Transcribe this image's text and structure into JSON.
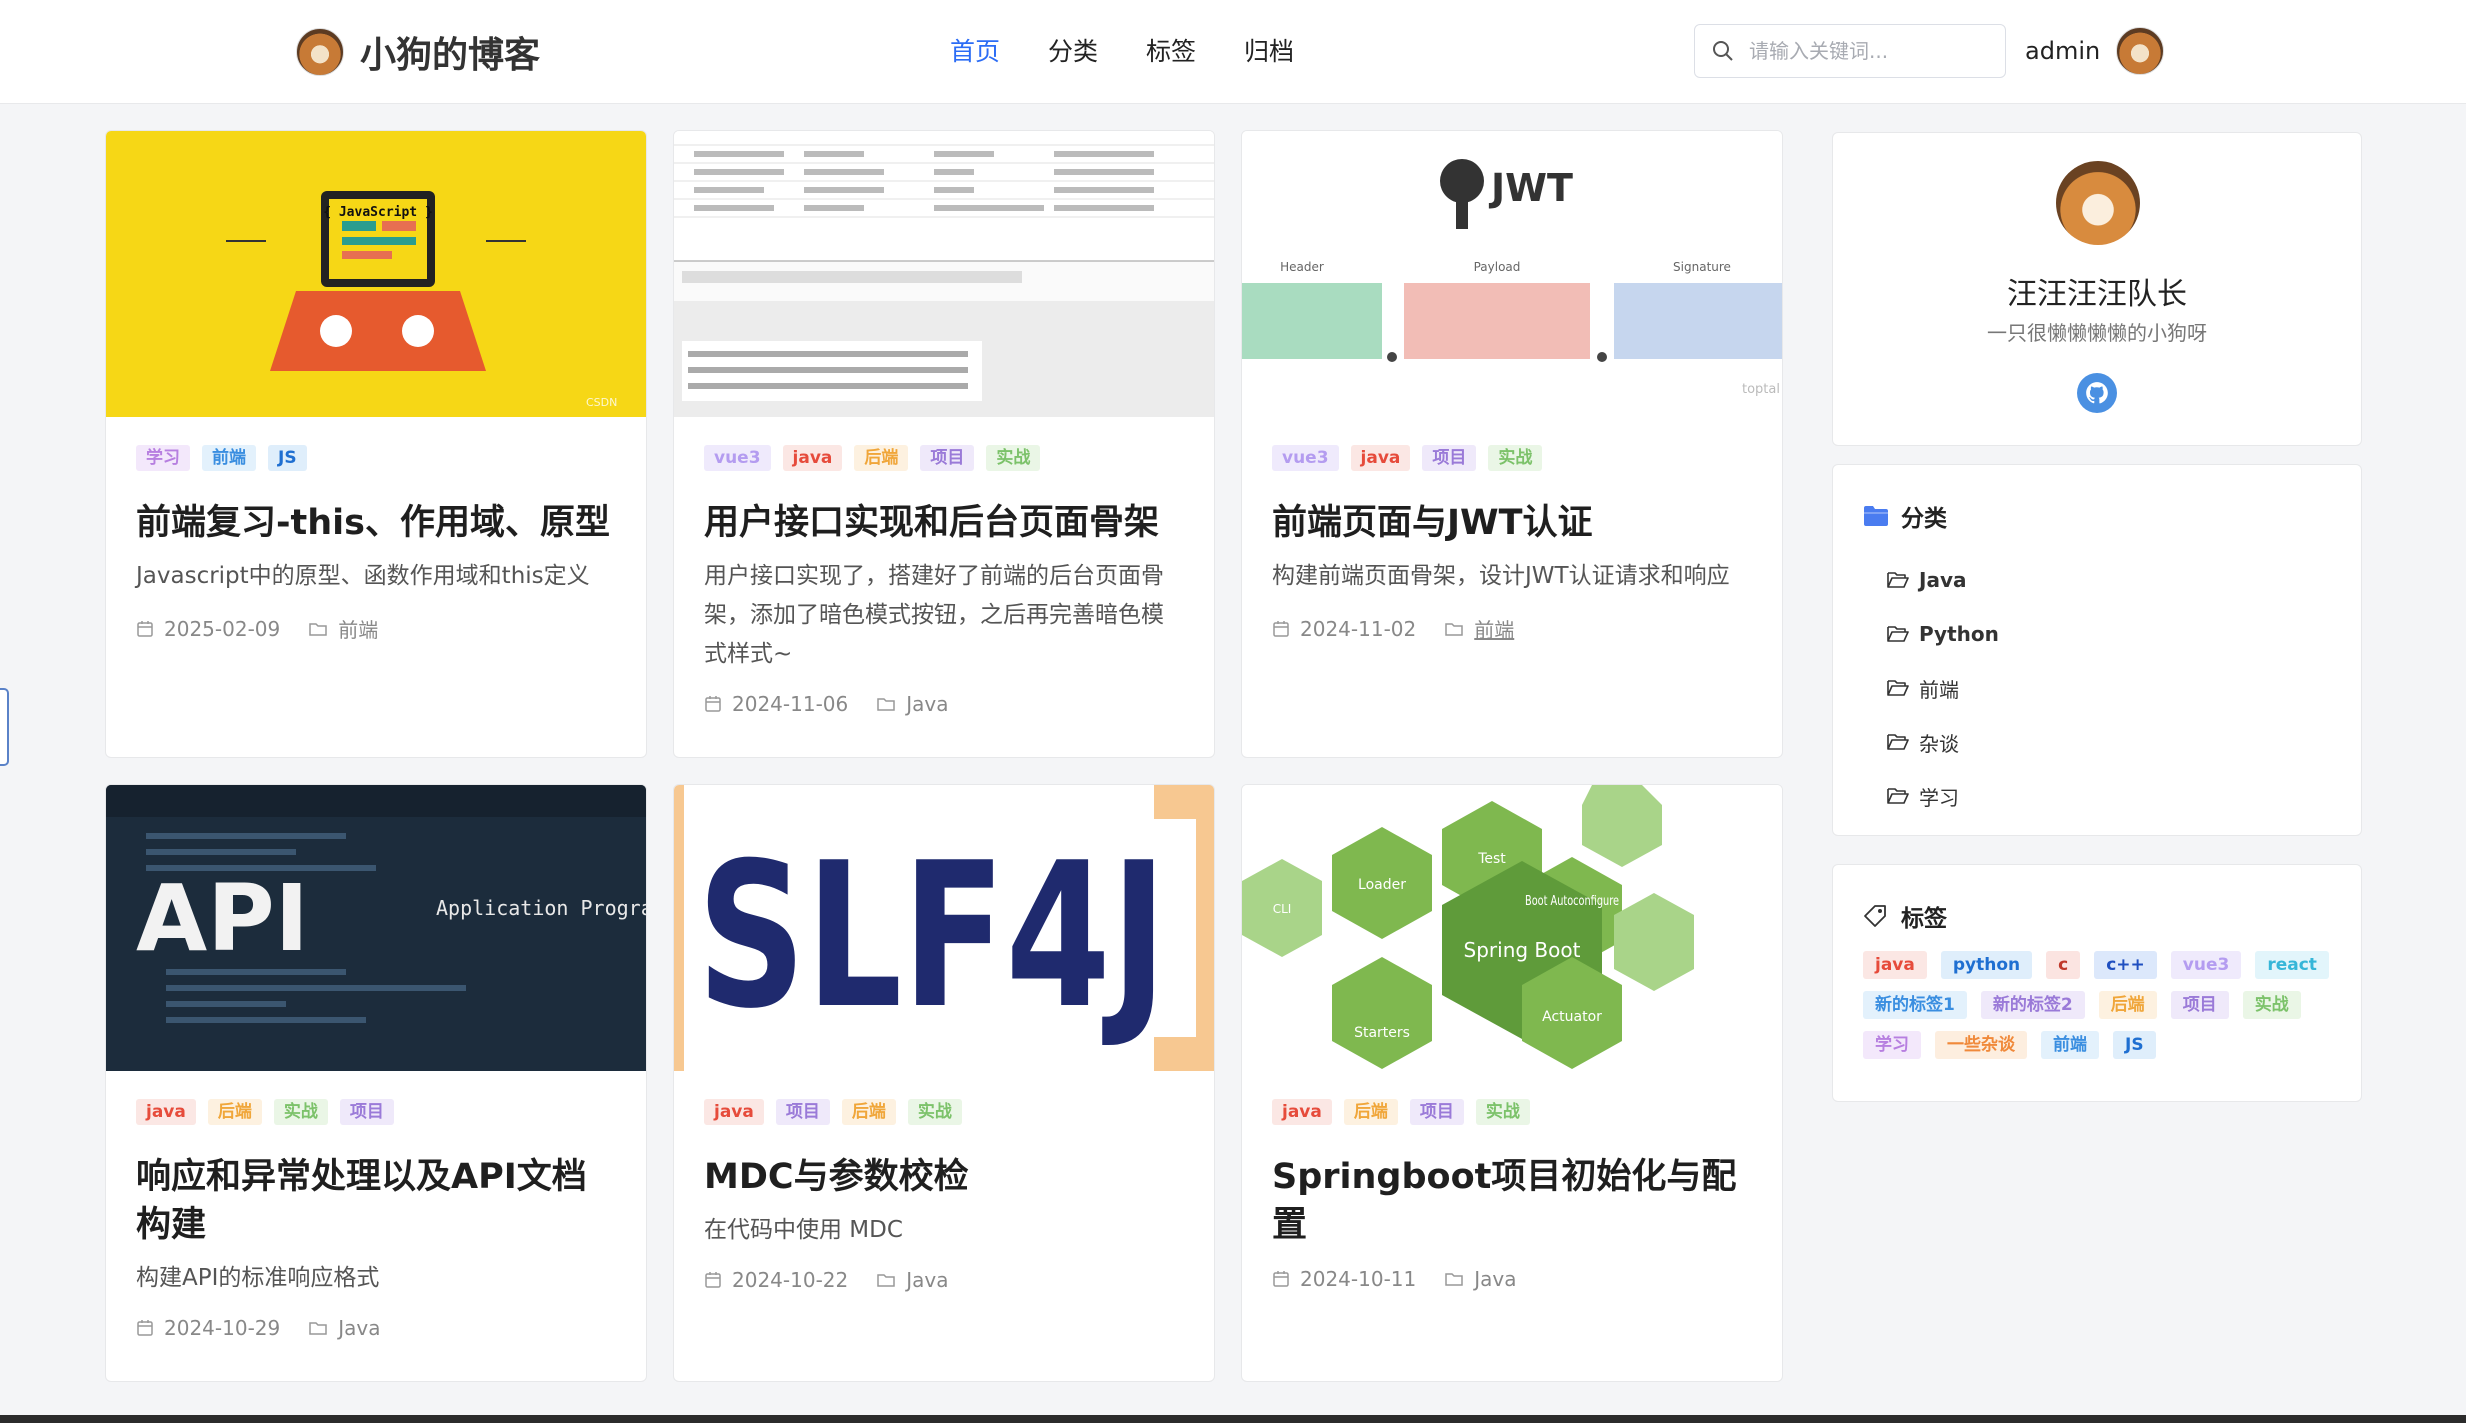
{
  "header": {
    "site_title": "小狗的博客",
    "nav": [
      {
        "label": "首页",
        "active": true
      },
      {
        "label": "分类",
        "active": false
      },
      {
        "label": "标签",
        "active": false
      },
      {
        "label": "归档",
        "active": false
      }
    ],
    "search_placeholder": "请输入关键词...",
    "username": "admin"
  },
  "tag_colors": {
    "学习": {
      "fg": "#b77fe0",
      "bg": "#f3e8fb"
    },
    "前端": {
      "fg": "#3a8ee0",
      "bg": "#e3f1fc"
    },
    "JS": {
      "fg": "#1f6fd1",
      "bg": "#dfeefb"
    },
    "vue3": {
      "fg": "#b49cf0",
      "bg": "#efeafc"
    },
    "java": {
      "fg": "#e64b3b",
      "bg": "#fbe7e4"
    },
    "后端": {
      "fg": "#f0a63a",
      "bg": "#fdf1e0"
    },
    "项目": {
      "fg": "#9a7ad8",
      "bg": "#efe9fa"
    },
    "实战": {
      "fg": "#7cc26a",
      "bg": "#eaf6e6"
    }
  },
  "cards": [
    {
      "tags": [
        "学习",
        "前端",
        "JS"
      ],
      "title": "前端复习-this、作用域、原型",
      "desc": "Javascript中的原型、函数作用域和this定义",
      "date": "2025-02-09",
      "category": "前端",
      "thumb_text": "{ JavaScript }"
    },
    {
      "tags": [
        "vue3",
        "java",
        "后端",
        "项目",
        "实战"
      ],
      "title": "用户接口实现和后台页面骨架",
      "desc": "用户接口实现了，搭建好了前端的后台页面骨架，添加了暗色模式按钮，之后再完善暗色模式样式~",
      "date": "2024-11-06",
      "category": "Java"
    },
    {
      "tags": [
        "vue3",
        "java",
        "项目",
        "实战"
      ],
      "title": "前端页面与JWT认证",
      "desc": "构建前端页面骨架，设计JWT认证请求和响应",
      "date": "2024-11-02",
      "category": "前端",
      "thumb_text": "JWT",
      "jwt_labels": [
        "Header",
        "Payload",
        "Signature"
      ]
    },
    {
      "tags": [
        "java",
        "后端",
        "实战",
        "项目"
      ],
      "title": "响应和异常处理以及API文档构建",
      "desc": "构建API的标准响应格式",
      "date": "2024-10-29",
      "category": "Java",
      "thumb_text": "API",
      "thumb_sub": "Application Programming Interface"
    },
    {
      "tags": [
        "java",
        "项目",
        "后端",
        "实战"
      ],
      "title": "MDC与参数校检",
      "desc": "在代码中使用 MDC",
      "date": "2024-10-22",
      "category": "Java",
      "thumb_text": "SLF4J"
    },
    {
      "tags": [
        "java",
        "后端",
        "项目",
        "实战"
      ],
      "title": "Springboot项目初始化与配置",
      "desc": "",
      "date": "2024-10-11",
      "category": "Java",
      "hex_labels": [
        "Spring Boot",
        "Test",
        "Loader",
        "CLI",
        "Boot Autoconfigure",
        "Actuator",
        "Starters"
      ]
    }
  ],
  "profile": {
    "name": "汪汪汪汪队长",
    "bio": "一只很懒懒懒懒的小狗呀"
  },
  "categories": {
    "title": "分类",
    "items": [
      "Java",
      "Python",
      "前端",
      "杂谈",
      "学习"
    ]
  },
  "tags_panel": {
    "title": "标签",
    "items": [
      {
        "label": "java",
        "fg": "#e64b3b",
        "bg": "#fbe7e4"
      },
      {
        "label": "python",
        "fg": "#1f6fd1",
        "bg": "#dfeefb"
      },
      {
        "label": "c",
        "fg": "#c0392b",
        "bg": "#fbe4e1"
      },
      {
        "label": "c++",
        "fg": "#1f4fc0",
        "bg": "#dce8fb"
      },
      {
        "label": "vue3",
        "fg": "#b49cf0",
        "bg": "#efeafc"
      },
      {
        "label": "react",
        "fg": "#36b6d8",
        "bg": "#e2f5fb"
      },
      {
        "label": "新的标签1",
        "fg": "#3a8ee0",
        "bg": "#e3f1fc"
      },
      {
        "label": "新的标签2",
        "fg": "#9a7ad8",
        "bg": "#efe9fa"
      },
      {
        "label": "后端",
        "fg": "#f0a63a",
        "bg": "#fdf1e0"
      },
      {
        "label": "项目",
        "fg": "#9a7ad8",
        "bg": "#efe9fa"
      },
      {
        "label": "实战",
        "fg": "#7cc26a",
        "bg": "#eaf6e6"
      },
      {
        "label": "学习",
        "fg": "#b77fe0",
        "bg": "#f3e8fb"
      },
      {
        "label": "一些杂谈",
        "fg": "#f0893a",
        "bg": "#fdeedf"
      },
      {
        "label": "前端",
        "fg": "#3a8ee0",
        "bg": "#e3f1fc"
      },
      {
        "label": "JS",
        "fg": "#1f6fd1",
        "bg": "#dfeefb"
      }
    ]
  }
}
